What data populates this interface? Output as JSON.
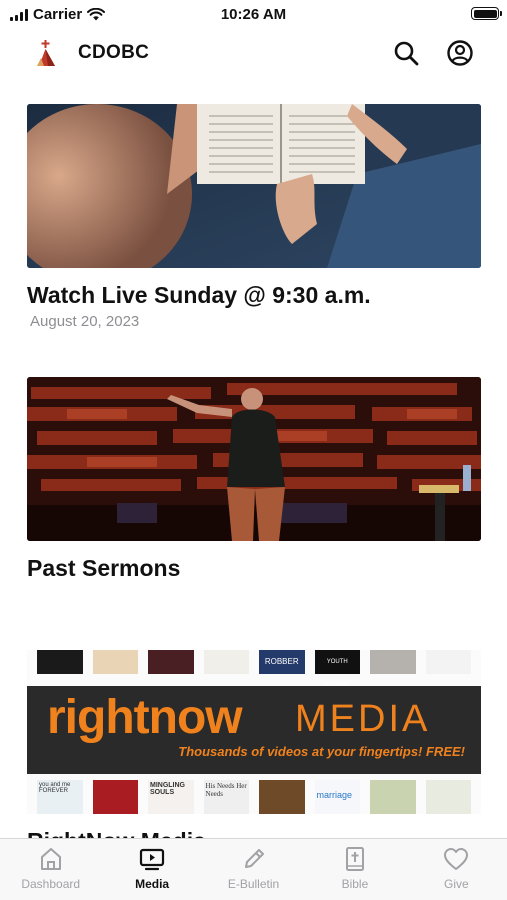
{
  "status_bar": {
    "carrier": "Carrier",
    "time": "10:26 AM"
  },
  "header": {
    "title": "CDOBC",
    "icons": [
      "church-logo-icon",
      "search-icon",
      "profile-icon"
    ]
  },
  "cards": [
    {
      "title": "Watch Live Sunday @ 9:30 a.m.",
      "date": "August 20, 2023",
      "image": "people-reading-bible-photo"
    },
    {
      "title": "Past Sermons",
      "image": "preacher-on-stage-photo"
    },
    {
      "title": "RightNow Media",
      "image": "rightnow-media-banner",
      "banner": {
        "brand_word": "rightnow",
        "media_word": "MEDIA",
        "tagline": "Thousands of videos at your fingertips! FREE!"
      },
      "book_covers_top": [
        "",
        "",
        "",
        "",
        "ROBBER",
        "YOUTH EDITION",
        "",
        ""
      ],
      "book_covers_bottom": [
        "you and me FOREVER",
        "",
        "MINGLING SOULS",
        "His Needs Her Needs",
        "",
        "marriage",
        "",
        ""
      ]
    }
  ],
  "tabs": [
    {
      "label": "Dashboard",
      "icon": "home-icon",
      "active": false
    },
    {
      "label": "Media",
      "icon": "tv-play-icon",
      "active": true
    },
    {
      "label": "E-Bulletin",
      "icon": "pencil-icon",
      "active": false
    },
    {
      "label": "Bible",
      "icon": "bible-cross-icon",
      "active": false
    },
    {
      "label": "Give",
      "icon": "heart-icon",
      "active": false
    }
  ],
  "colors": {
    "active_tab": "#111111",
    "inactive_tab": "#a2a2a6",
    "date_gray": "#8e8e93",
    "rightnow_orange": "#f0821e",
    "logo_red": "#c0392b"
  }
}
